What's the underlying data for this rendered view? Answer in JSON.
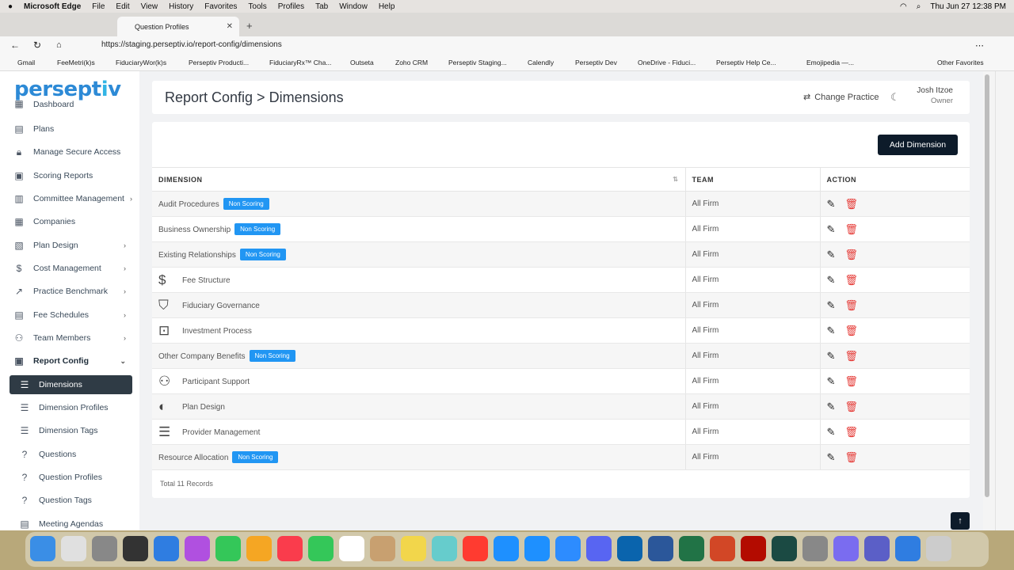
{
  "mac_menu": {
    "app": "Microsoft Edge",
    "items": [
      "File",
      "Edit",
      "View",
      "History",
      "Favorites",
      "Tools",
      "Profiles",
      "Tab",
      "Window",
      "Help"
    ],
    "clock": "Thu Jun 27  12:38 PM"
  },
  "browser": {
    "tab_title": "Question Profiles",
    "url": "https://staging.perseptiv.io/report-config/dimensions"
  },
  "bookmarks": [
    "Gmail",
    "FeeMetri(k)s",
    "FiduciaryWor(k)s",
    "Perseptiv Producti...",
    "FiduciaryRx™ Cha...",
    "Outseta",
    "Zoho CRM",
    "Perseptiv Staging...",
    "Calendly",
    "Perseptiv Dev",
    "OneDrive - Fiduci...",
    "Perseptiv Help Ce...",
    "Emojipedia —...",
    "Other Favorites"
  ],
  "logo": {
    "text": "persept",
    "dot": "i",
    "end": "v"
  },
  "sidebar": {
    "items": [
      {
        "label": "Dashboard",
        "icon": "grid-icon"
      },
      {
        "label": "Plans",
        "icon": "clipboard-icon"
      },
      {
        "label": "Manage Secure Access",
        "icon": "lock-icon"
      },
      {
        "label": "Scoring Reports",
        "icon": "report-icon"
      },
      {
        "label": "Committee Management",
        "icon": "calendar-icon"
      },
      {
        "label": "Companies",
        "icon": "building-icon"
      },
      {
        "label": "Plan Design",
        "icon": "design-icon"
      },
      {
        "label": "Cost Management",
        "icon": "money-icon"
      },
      {
        "label": "Practice Benchmark",
        "icon": "chart-icon"
      },
      {
        "label": "Fee Schedules",
        "icon": "document-icon"
      },
      {
        "label": "Team Members",
        "icon": "people-icon"
      },
      {
        "label": "Report Config",
        "icon": "config-icon"
      },
      {
        "label": "Dimensions",
        "icon": "sliders-icon"
      },
      {
        "label": "Dimension Profiles",
        "icon": "sliders-icon"
      },
      {
        "label": "Dimension Tags",
        "icon": "sliders-icon"
      },
      {
        "label": "Questions",
        "icon": "question-icon"
      },
      {
        "label": "Question Profiles",
        "icon": "question-icon"
      },
      {
        "label": "Question Tags",
        "icon": "question-icon"
      },
      {
        "label": "Meeting Agendas",
        "icon": "agenda-icon"
      }
    ]
  },
  "header": {
    "title": "Report Config > Dimensions",
    "change_practice": "Change Practice",
    "user_name": "Josh Itzoe",
    "user_role": "Owner"
  },
  "main": {
    "add_button": "Add Dimension",
    "columns": [
      "DIMENSION",
      "TEAM",
      "ACTION"
    ],
    "badge_label": "Non Scoring",
    "rows": [
      {
        "name": "Audit Procedures",
        "non_scoring": true,
        "icon": "",
        "team": "All Firm"
      },
      {
        "name": "Business Ownership",
        "non_scoring": true,
        "icon": "",
        "team": "All Firm"
      },
      {
        "name": "Existing Relationships",
        "non_scoring": true,
        "icon": "",
        "team": "All Firm"
      },
      {
        "name": "Fee Structure",
        "non_scoring": false,
        "icon": "dollar-circle-icon",
        "team": "All Firm"
      },
      {
        "name": "Fiduciary Governance",
        "non_scoring": false,
        "icon": "shield-check-icon",
        "team": "All Firm"
      },
      {
        "name": "Investment Process",
        "non_scoring": false,
        "icon": "presentation-chart-icon",
        "team": "All Firm"
      },
      {
        "name": "Other Company Benefits",
        "non_scoring": true,
        "icon": "",
        "team": "All Firm"
      },
      {
        "name": "Participant Support",
        "non_scoring": false,
        "icon": "support-people-icon",
        "team": "All Firm"
      },
      {
        "name": "Plan Design",
        "non_scoring": false,
        "icon": "palette-icon",
        "team": "All Firm"
      },
      {
        "name": "Provider Management",
        "non_scoring": false,
        "icon": "checklist-icon",
        "team": "All Firm"
      },
      {
        "name": "Resource Allocation",
        "non_scoring": true,
        "icon": "",
        "team": "All Firm"
      }
    ],
    "total": "Total 11 Records"
  },
  "colors": {
    "brand": "#2d8ad6",
    "badge": "#2196f3",
    "primary_btn": "#0d1b2a",
    "delete": "#e53935",
    "active_nav": "#2f3b45"
  }
}
